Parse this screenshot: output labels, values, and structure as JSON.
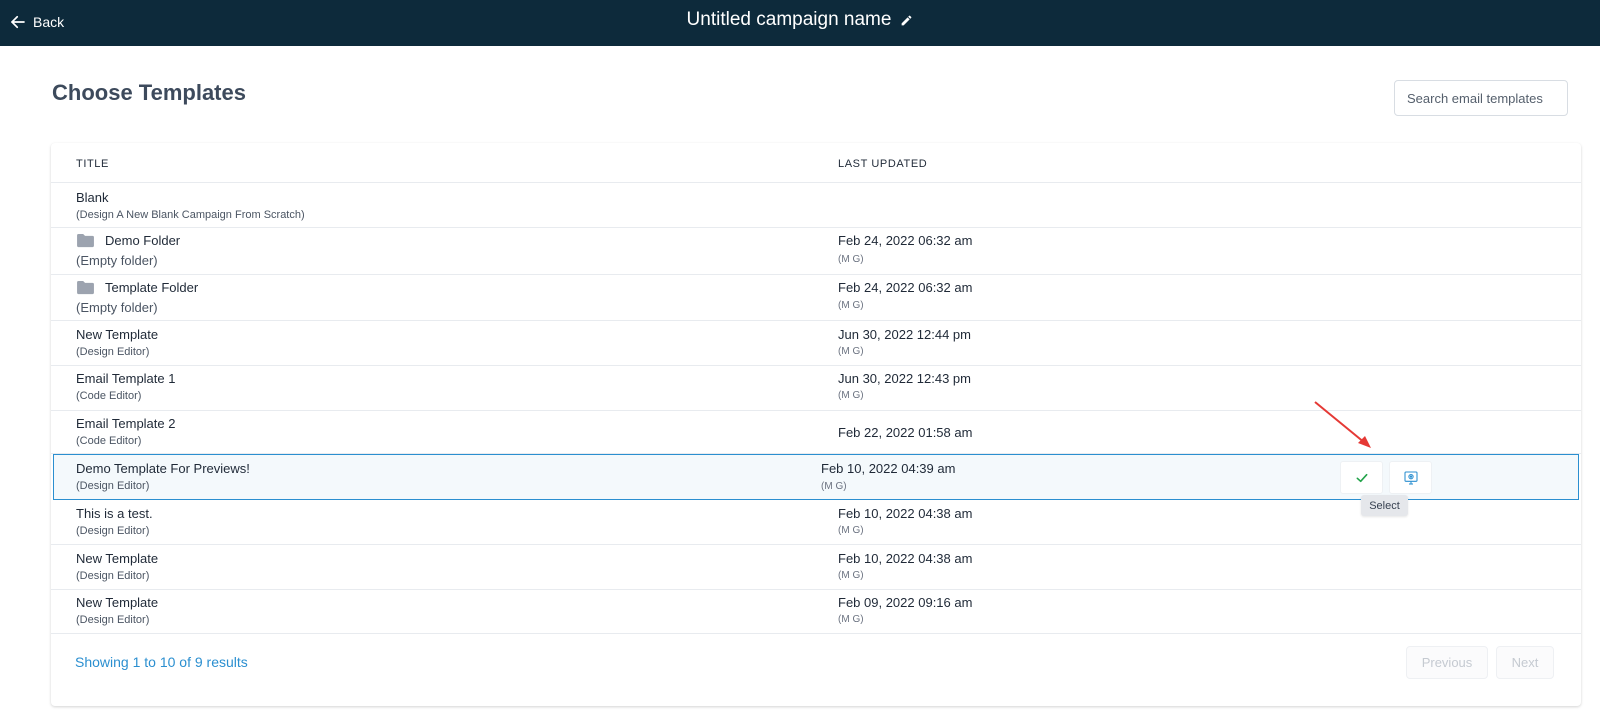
{
  "header": {
    "back_label": "Back",
    "campaign_name": "Untitled campaign name",
    "bg_color": "#0d2a3b"
  },
  "page": {
    "title": "Choose Templates",
    "search_placeholder": "Search email templates"
  },
  "table": {
    "columns": [
      "TITLE",
      "LAST UPDATED"
    ],
    "rows": [
      {
        "title": "Blank",
        "subtitle": "(Design A New Blank Campaign From Scratch)",
        "date": "",
        "user": ""
      },
      {
        "title": "Demo Folder",
        "subtitle": "(Empty folder)",
        "date": "Feb 24, 2022 06:32 am",
        "user": "(M G)",
        "icon": "folder-icon"
      },
      {
        "title": "Template Folder",
        "subtitle": "(Empty folder)",
        "date": "Feb 24, 2022 06:32 am",
        "user": "(M G)",
        "icon": "folder-icon"
      },
      {
        "title": "New Template",
        "subtitle": "(Design Editor)",
        "date": "Jun 30, 2022 12:44 pm",
        "user": "(M G)"
      },
      {
        "title": "Email Template 1",
        "subtitle": "(Code Editor)",
        "date": "Jun 30, 2022 12:43 pm",
        "user": "(M G)"
      },
      {
        "title": "Email Template 2",
        "subtitle": "(Code Editor)",
        "date": "Feb 22, 2022 01:58 am",
        "user": ""
      },
      {
        "title": "Demo Template For Previews!",
        "subtitle": "(Design Editor)",
        "date": "Feb 10, 2022 04:39 am",
        "user": "(M G)",
        "selected": true
      },
      {
        "title": "This is a test.",
        "subtitle": "(Design Editor)",
        "date": "Feb 10, 2022 04:38 am",
        "user": "(M G)"
      },
      {
        "title": "New Template",
        "subtitle": "(Design Editor)",
        "date": "Feb 10, 2022 04:38 am",
        "user": "(M G)"
      },
      {
        "title": "New Template",
        "subtitle": "(Design Editor)",
        "date": "Feb 09, 2022 09:16 am",
        "user": "(M G)"
      }
    ],
    "row_actions": {
      "select_icon": "check-icon",
      "preview_icon": "preview-icon",
      "tooltip": "Select"
    }
  },
  "footer": {
    "showing": "Showing 1 to 10 of 9 results",
    "previous": "Previous",
    "next": "Next"
  },
  "colors": {
    "accent": "#2b8fd0",
    "check": "#22a34a",
    "annotation_arrow": "#e53935"
  }
}
